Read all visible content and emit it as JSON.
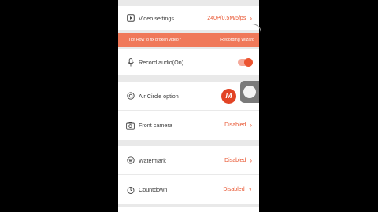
{
  "video_settings": {
    "label": "Video settings",
    "value": "240P/0.5M/5fps",
    "icon": "video-icon"
  },
  "banner": {
    "tip": "Tip! How to fix broken video?",
    "link": "Recording Wizard"
  },
  "record_audio": {
    "label": "Record audio(On)",
    "enabled": true,
    "icon": "microphone-icon"
  },
  "air_circle": {
    "label": "Air Circle option",
    "logo_letter": "M",
    "icon": "air-circle-icon"
  },
  "front_camera": {
    "label": "Front camera",
    "value": "Disabled",
    "icon": "camera-icon"
  },
  "watermark": {
    "label": "Watermark",
    "value": "Disabled",
    "icon": "watermark-icon"
  },
  "countdown": {
    "label": "Countdown",
    "value": "Disabled",
    "icon": "timer-icon"
  },
  "colors": {
    "accent": "#e8532e",
    "banner": "#f0795a",
    "background": "#e9e9e9"
  }
}
